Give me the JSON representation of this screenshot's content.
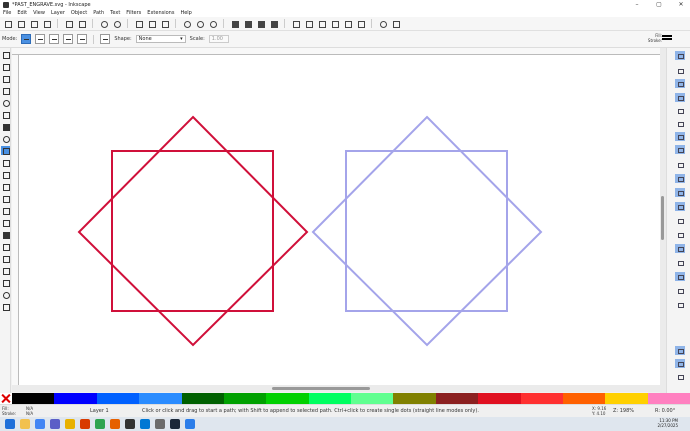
{
  "window": {
    "title": "*PAST_ENGRAVE.svg - Inkscape",
    "controls": [
      "–",
      "▢",
      "✕"
    ]
  },
  "menu": [
    "File",
    "Edit",
    "View",
    "Layer",
    "Object",
    "Path",
    "Text",
    "Filters",
    "Extensions",
    "Help"
  ],
  "tool_controls": {
    "mode_label": "Mode:",
    "shape_label": "Shape:",
    "shape_value": "None",
    "scale_label": "Scale:",
    "scale_value": "1.00",
    "fill_label": "Fill:",
    "stroke_label": "Stroke:"
  },
  "canvas": {
    "shapes": [
      {
        "name": "red-star-square",
        "color": "#d0103a"
      },
      {
        "name": "lavender-star-square",
        "color": "#a4a4ea"
      }
    ]
  },
  "palette": [
    "#000000",
    "#0000ff",
    "#0060ff",
    "#2b8cff",
    "#006000",
    "#00a000",
    "#00d000",
    "#00ff60",
    "#60ff90",
    "#808000",
    "#8b2020",
    "#e01020",
    "#ff3030",
    "#ff6000",
    "#ffd000",
    "#ff80c0"
  ],
  "status": {
    "fill_label": "Fill:",
    "fill_value": "N/A",
    "stroke_label": "Stroke:",
    "stroke_value": "N/A",
    "layer": "Layer 1",
    "message": "Click or click and drag to start a path; with Shift to append to selected path. Ctrl+click to create single dots (straight line modes only).",
    "x_label": "X:",
    "x_value": "9.16",
    "y_label": "Y:",
    "y_value": "4.10",
    "z_label": "Z:",
    "zoom": "198%",
    "r_label": "R:",
    "rotation": "0.00°"
  },
  "taskbar": {
    "time": "11:30 PM",
    "date": "2/27/2025"
  }
}
